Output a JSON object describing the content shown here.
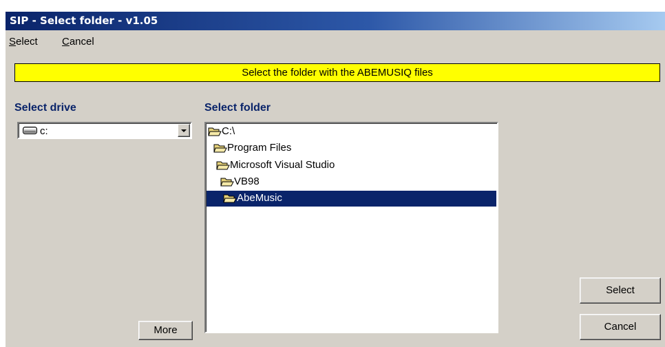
{
  "window": {
    "title": "SIP - Select folder - v1.05"
  },
  "menu": [
    {
      "label": "Select",
      "mnemonic": "S",
      "rest": "elect"
    },
    {
      "label": "Cancel",
      "mnemonic": "C",
      "rest": "ancel"
    }
  ],
  "banner": {
    "text": "Select the folder with the ABEMUSIQ files",
    "color": "#ffff00"
  },
  "drive": {
    "label": "Select drive",
    "value": "c:",
    "icon": "hard-drive-icon"
  },
  "folders": {
    "label": "Select folder",
    "items": [
      {
        "name": "C:\\",
        "icon": "open-folder-icon",
        "selected": false
      },
      {
        "name": "Program Files",
        "icon": "open-folder-icon",
        "selected": false
      },
      {
        "name": "Microsoft Visual Studio",
        "icon": "open-folder-icon",
        "selected": false
      },
      {
        "name": "VB98",
        "icon": "open-folder-icon",
        "selected": false
      },
      {
        "name": "AbeMusic",
        "icon": "open-folder-icon",
        "selected": true
      }
    ]
  },
  "buttons": {
    "more": "More",
    "select": "Select",
    "cancel": "Cancel"
  },
  "colors": {
    "selection": "#0a246a",
    "titlebar_start": "#0a246a",
    "titlebar_end": "#a6caf0",
    "label": "#0a246a"
  }
}
